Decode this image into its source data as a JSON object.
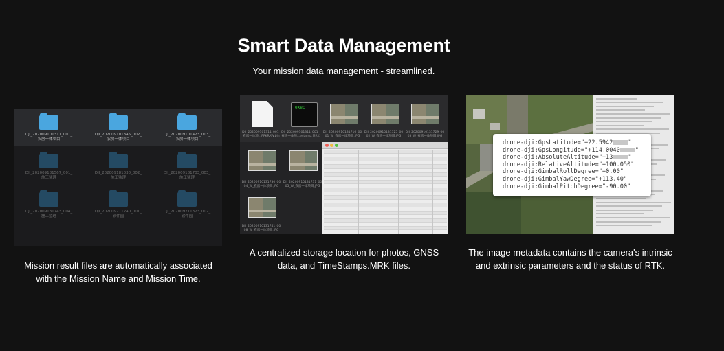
{
  "header": {
    "title": "Smart Data Management",
    "subtitle": "Your mission data management - streamlined."
  },
  "panel_folders": {
    "folders": [
      {
        "line1": "DJI_202009101311_001_",
        "line2": "农房一体项目",
        "state": "selected"
      },
      {
        "line1": "DJI_202009101345_002_",
        "line2": "农房一体项目",
        "state": "selected"
      },
      {
        "line1": "DJI_202009101423_003_",
        "line2": "农房一体项目",
        "state": "selected"
      },
      {
        "line1": "DJI_202009181567_001_",
        "line2": "施工监理",
        "state": "normal"
      },
      {
        "line1": "DJI_202009181030_002_",
        "line2": "施工监理",
        "state": "normal"
      },
      {
        "line1": "DJI_202009181703_003_",
        "line2": "施工监理",
        "state": "normal"
      },
      {
        "line1": "DJI_202009181743_004_",
        "line2": "施工监理",
        "state": "normal"
      },
      {
        "line1": "DJI_202009211240_001_",
        "line2": "软件园",
        "state": "normal"
      },
      {
        "line1": "DJI_202009211323_002_",
        "line2": "软件园",
        "state": "normal"
      }
    ],
    "caption": "Mission result files are automatically associated with the Mission Name and Mission Time."
  },
  "panel_storage": {
    "exec_label": "exec",
    "top_labels": [
      "DJI_202009101311_001_农房一体项...PPKRAW.bin",
      "DJI_202009101311_001_农房一体项...estamp.MRK",
      "DJI_20200910131716_00 01_W_农房一体项目.JPG",
      "DJI_20200910131725_00 02_W_农房一体项目.JPG",
      "DJI_20200910131729_00 03_W_农房一体项目.JPG"
    ],
    "left_labels": [
      "DJI_20200910131730_00 04_W_农房一体项目.JPG",
      "DJI_20200910131731_00 05_W_农房一体项目.JPG",
      "DJI_20200910131741_00 08_W_农房一体项目.JPG"
    ],
    "caption": "A centralized storage location for photos, GNSS data, and TimeStamps.MRK files."
  },
  "panel_metadata": {
    "lines": [
      {
        "key": "drone-dji:GpsLatitude=",
        "value": "\"+22.5942",
        "tail": "\"",
        "redacted": true
      },
      {
        "key": "drone-dji:GpsLongitude=",
        "value": "\"+114.0040",
        "tail": "\"",
        "redacted": true
      },
      {
        "key": "drone-dji:AbsoluteAltitude=",
        "value": "\"+13",
        "tail": "\"",
        "redacted": true
      },
      {
        "key": "drone-dji:RelativeAltitude=",
        "value": "\"+100.050\"",
        "tail": "",
        "redacted": false
      },
      {
        "key": "drone-dji:GimbalRollDegree=",
        "value": "\"+0.00\"",
        "tail": "",
        "redacted": false
      },
      {
        "key": "drone-dji:GimbalYawDegree=",
        "value": "\"+113.40\"",
        "tail": "",
        "redacted": false
      },
      {
        "key": "drone-dji:GimbalPitchDegree=",
        "value": "\"-90.00\"",
        "tail": "",
        "redacted": false
      }
    ],
    "caption": "The image metadata contains the camera's intrinsic and extrinsic parameters and the status of RTK."
  },
  "colors": {
    "background": "#121212",
    "folder_bright": "#4aa6df",
    "folder_dim": "#244a63"
  }
}
